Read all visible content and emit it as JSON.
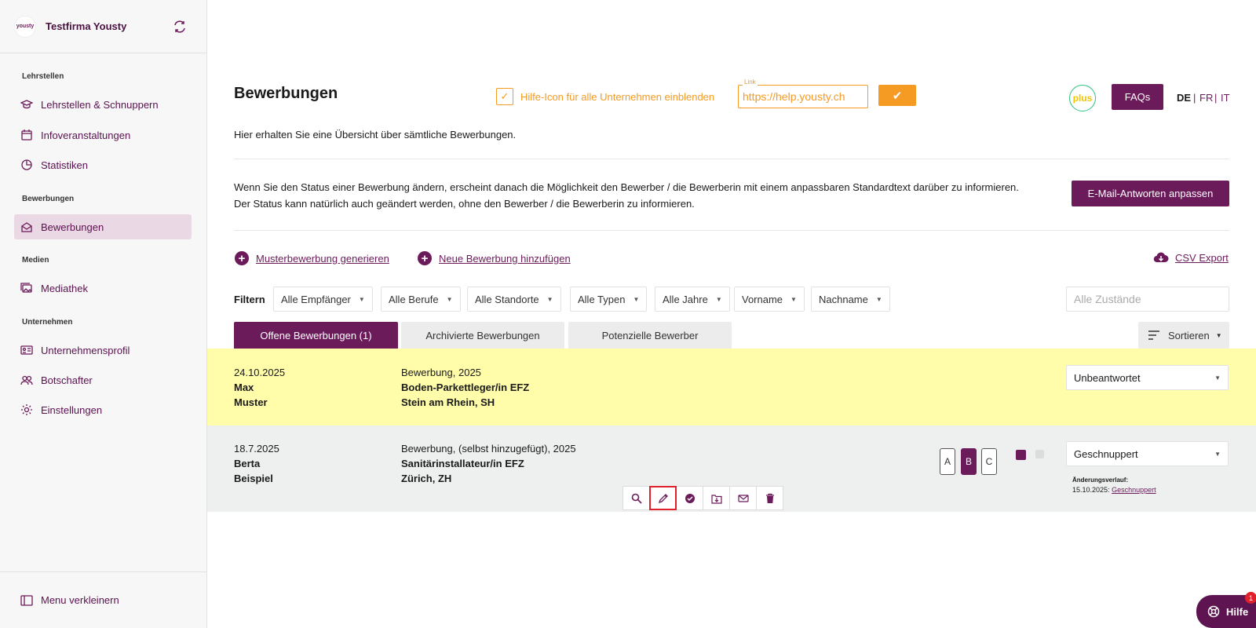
{
  "colors": {
    "brand": "#6b1a5a",
    "accent_orange": "#f59a23",
    "row_highlight": "#fffcaa",
    "row_grey": "#eef0f0",
    "active_nav": "#ead9e4",
    "alert": "#e0202a"
  },
  "sidebar": {
    "logo_text": "yousty",
    "company": "Testfirma Yousty",
    "sections": {
      "lehrstellen": "Lehrstellen",
      "bewerbungen": "Bewerbungen",
      "medien": "Medien",
      "unternehmen": "Unternehmen"
    },
    "items": {
      "lehrstellen": "Lehrstellen & Schnuppern",
      "infoveranstaltungen": "Infoveranstaltungen",
      "statistiken": "Statistiken",
      "bewerbungen": "Bewerbungen",
      "mediathek": "Mediathek",
      "unternehmensprofil": "Unternehmensprofil",
      "botschafter": "Botschafter",
      "einstellungen": "Einstellungen"
    },
    "collapse_label": "Menu verkleinern"
  },
  "header": {
    "title": "Bewerbungen",
    "help_icon_label": "Hilfe-Icon für alle Unternehmen einblenden",
    "link_caption": "Link",
    "link_value": "https://help.yousty.ch",
    "confirm_symbol": "✔",
    "plus_badge": "plus",
    "faq_label": "FAQs",
    "languages": [
      "DE",
      "FR",
      "IT"
    ],
    "language_separator": "|"
  },
  "intro": "Hier erhalten Sie eine Übersicht über sämtliche Bewerbungen.",
  "status_info": "Wenn Sie den Status einer Bewerbung ändern, erscheint danach die Möglichkeit den Bewerber / die Bewerberin mit einem anpassbaren Standardtext darüber zu informieren. Der Status kann natürlich auch geändert werden, ohne den Bewerber / die Bewerberin zu informieren.",
  "email_button": "E-Mail-Antworten anpassen",
  "actions": {
    "generate": "Musterbewerbung generieren",
    "add": "Neue Bewerbung hinzufügen",
    "csv": "CSV Export"
  },
  "filters": {
    "label": "Filtern",
    "items": [
      "Alle Empfänger",
      "Alle Berufe",
      "Alle Standorte",
      "Alle Typen",
      "Alle Jahre",
      "Vorname",
      "Nachname"
    ],
    "status_placeholder": "Alle Zustände"
  },
  "tabs": [
    "Offene Bewerbungen (1)",
    "Archivierte Bewerbungen",
    "Potenzielle Bewerber"
  ],
  "sort_label": "Sortieren",
  "applications": [
    {
      "date": "24.10.2025",
      "first_name": "Max",
      "last_name": "Muster",
      "type": "Bewerbung, 2025",
      "profession": "Boden-Parkettleger/in EFZ",
      "location": "Stein am Rhein, SH",
      "status": "Unbeantwortet"
    },
    {
      "date": "18.7.2025",
      "first_name": "Berta",
      "last_name": "Beispiel",
      "type": "Bewerbung, (selbst hinzugefügt), 2025",
      "profession": "Sanitärinstallateur/in EFZ",
      "location": "Zürich, ZH",
      "status": "Geschnuppert",
      "ratings": [
        "A",
        "B",
        "C"
      ],
      "rating_selected": "B",
      "change_title": "Änderungsverlauf:",
      "change_date": "15.10.2025:",
      "change_value": "Geschnuppert"
    }
  ],
  "row_icons": [
    "search-icon",
    "pencil-icon",
    "check-circle-icon",
    "archive-icon",
    "mail-icon",
    "trash-icon"
  ],
  "help_fab": {
    "label": "Hilfe",
    "badge": "1"
  }
}
